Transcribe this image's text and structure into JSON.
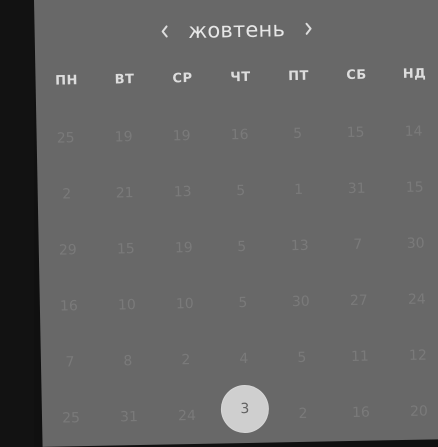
{
  "calendar": {
    "month_label": "жовтень",
    "prev_icon": "chevron-left-icon",
    "next_icon": "chevron-right-icon",
    "weekdays": [
      "ПН",
      "ВТ",
      "СР",
      "ЧТ",
      "ПТ",
      "СБ",
      "НД"
    ],
    "rows": [
      [
        "25",
        "19",
        "19",
        "16",
        "5",
        "15",
        "14"
      ],
      [
        "2",
        "21",
        "13",
        "5",
        "1",
        "31",
        "15"
      ],
      [
        "29",
        "15",
        "19",
        "5",
        "13",
        "7",
        "30"
      ],
      [
        "16",
        "10",
        "10",
        "5",
        "30",
        "27",
        "24"
      ],
      [
        "7",
        "8",
        "2",
        "4",
        "5",
        "11",
        "12"
      ],
      [
        "25",
        "31",
        "24",
        "3",
        "2",
        "16",
        "20"
      ]
    ],
    "selected_day": "3"
  }
}
